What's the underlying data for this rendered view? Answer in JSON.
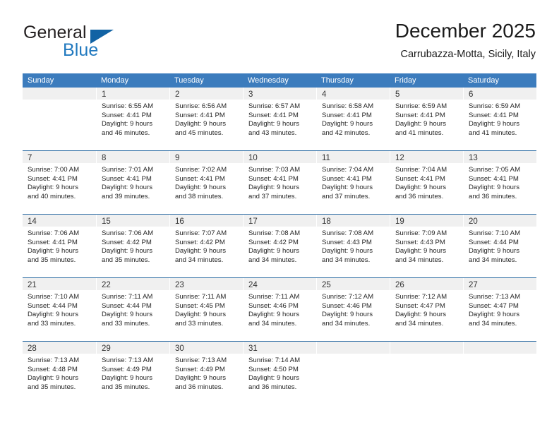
{
  "brand": {
    "name_part1": "General",
    "name_part2": "Blue",
    "logo_icon": "triangle-logo-icon",
    "accent_color": "#2179bf"
  },
  "header": {
    "title": "December 2025",
    "subtitle": "Carrubazza-Motta, Sicily, Italy"
  },
  "calendar": {
    "header_bg": "#3c7cbd",
    "daynum_bg": "#f0f0f0",
    "separator_color": "#2e6da4",
    "weekdays": [
      "Sunday",
      "Monday",
      "Tuesday",
      "Wednesday",
      "Thursday",
      "Friday",
      "Saturday"
    ],
    "weeks": [
      [
        {
          "day": "",
          "sunrise": "",
          "sunset": "",
          "daylight1": "",
          "daylight2": ""
        },
        {
          "day": "1",
          "sunrise": "Sunrise: 6:55 AM",
          "sunset": "Sunset: 4:41 PM",
          "daylight1": "Daylight: 9 hours",
          "daylight2": "and 46 minutes."
        },
        {
          "day": "2",
          "sunrise": "Sunrise: 6:56 AM",
          "sunset": "Sunset: 4:41 PM",
          "daylight1": "Daylight: 9 hours",
          "daylight2": "and 45 minutes."
        },
        {
          "day": "3",
          "sunrise": "Sunrise: 6:57 AM",
          "sunset": "Sunset: 4:41 PM",
          "daylight1": "Daylight: 9 hours",
          "daylight2": "and 43 minutes."
        },
        {
          "day": "4",
          "sunrise": "Sunrise: 6:58 AM",
          "sunset": "Sunset: 4:41 PM",
          "daylight1": "Daylight: 9 hours",
          "daylight2": "and 42 minutes."
        },
        {
          "day": "5",
          "sunrise": "Sunrise: 6:59 AM",
          "sunset": "Sunset: 4:41 PM",
          "daylight1": "Daylight: 9 hours",
          "daylight2": "and 41 minutes."
        },
        {
          "day": "6",
          "sunrise": "Sunrise: 6:59 AM",
          "sunset": "Sunset: 4:41 PM",
          "daylight1": "Daylight: 9 hours",
          "daylight2": "and 41 minutes."
        }
      ],
      [
        {
          "day": "7",
          "sunrise": "Sunrise: 7:00 AM",
          "sunset": "Sunset: 4:41 PM",
          "daylight1": "Daylight: 9 hours",
          "daylight2": "and 40 minutes."
        },
        {
          "day": "8",
          "sunrise": "Sunrise: 7:01 AM",
          "sunset": "Sunset: 4:41 PM",
          "daylight1": "Daylight: 9 hours",
          "daylight2": "and 39 minutes."
        },
        {
          "day": "9",
          "sunrise": "Sunrise: 7:02 AM",
          "sunset": "Sunset: 4:41 PM",
          "daylight1": "Daylight: 9 hours",
          "daylight2": "and 38 minutes."
        },
        {
          "day": "10",
          "sunrise": "Sunrise: 7:03 AM",
          "sunset": "Sunset: 4:41 PM",
          "daylight1": "Daylight: 9 hours",
          "daylight2": "and 37 minutes."
        },
        {
          "day": "11",
          "sunrise": "Sunrise: 7:04 AM",
          "sunset": "Sunset: 4:41 PM",
          "daylight1": "Daylight: 9 hours",
          "daylight2": "and 37 minutes."
        },
        {
          "day": "12",
          "sunrise": "Sunrise: 7:04 AM",
          "sunset": "Sunset: 4:41 PM",
          "daylight1": "Daylight: 9 hours",
          "daylight2": "and 36 minutes."
        },
        {
          "day": "13",
          "sunrise": "Sunrise: 7:05 AM",
          "sunset": "Sunset: 4:41 PM",
          "daylight1": "Daylight: 9 hours",
          "daylight2": "and 36 minutes."
        }
      ],
      [
        {
          "day": "14",
          "sunrise": "Sunrise: 7:06 AM",
          "sunset": "Sunset: 4:41 PM",
          "daylight1": "Daylight: 9 hours",
          "daylight2": "and 35 minutes."
        },
        {
          "day": "15",
          "sunrise": "Sunrise: 7:06 AM",
          "sunset": "Sunset: 4:42 PM",
          "daylight1": "Daylight: 9 hours",
          "daylight2": "and 35 minutes."
        },
        {
          "day": "16",
          "sunrise": "Sunrise: 7:07 AM",
          "sunset": "Sunset: 4:42 PM",
          "daylight1": "Daylight: 9 hours",
          "daylight2": "and 34 minutes."
        },
        {
          "day": "17",
          "sunrise": "Sunrise: 7:08 AM",
          "sunset": "Sunset: 4:42 PM",
          "daylight1": "Daylight: 9 hours",
          "daylight2": "and 34 minutes."
        },
        {
          "day": "18",
          "sunrise": "Sunrise: 7:08 AM",
          "sunset": "Sunset: 4:43 PM",
          "daylight1": "Daylight: 9 hours",
          "daylight2": "and 34 minutes."
        },
        {
          "day": "19",
          "sunrise": "Sunrise: 7:09 AM",
          "sunset": "Sunset: 4:43 PM",
          "daylight1": "Daylight: 9 hours",
          "daylight2": "and 34 minutes."
        },
        {
          "day": "20",
          "sunrise": "Sunrise: 7:10 AM",
          "sunset": "Sunset: 4:44 PM",
          "daylight1": "Daylight: 9 hours",
          "daylight2": "and 34 minutes."
        }
      ],
      [
        {
          "day": "21",
          "sunrise": "Sunrise: 7:10 AM",
          "sunset": "Sunset: 4:44 PM",
          "daylight1": "Daylight: 9 hours",
          "daylight2": "and 33 minutes."
        },
        {
          "day": "22",
          "sunrise": "Sunrise: 7:11 AM",
          "sunset": "Sunset: 4:44 PM",
          "daylight1": "Daylight: 9 hours",
          "daylight2": "and 33 minutes."
        },
        {
          "day": "23",
          "sunrise": "Sunrise: 7:11 AM",
          "sunset": "Sunset: 4:45 PM",
          "daylight1": "Daylight: 9 hours",
          "daylight2": "and 33 minutes."
        },
        {
          "day": "24",
          "sunrise": "Sunrise: 7:11 AM",
          "sunset": "Sunset: 4:46 PM",
          "daylight1": "Daylight: 9 hours",
          "daylight2": "and 34 minutes."
        },
        {
          "day": "25",
          "sunrise": "Sunrise: 7:12 AM",
          "sunset": "Sunset: 4:46 PM",
          "daylight1": "Daylight: 9 hours",
          "daylight2": "and 34 minutes."
        },
        {
          "day": "26",
          "sunrise": "Sunrise: 7:12 AM",
          "sunset": "Sunset: 4:47 PM",
          "daylight1": "Daylight: 9 hours",
          "daylight2": "and 34 minutes."
        },
        {
          "day": "27",
          "sunrise": "Sunrise: 7:13 AM",
          "sunset": "Sunset: 4:47 PM",
          "daylight1": "Daylight: 9 hours",
          "daylight2": "and 34 minutes."
        }
      ],
      [
        {
          "day": "28",
          "sunrise": "Sunrise: 7:13 AM",
          "sunset": "Sunset: 4:48 PM",
          "daylight1": "Daylight: 9 hours",
          "daylight2": "and 35 minutes."
        },
        {
          "day": "29",
          "sunrise": "Sunrise: 7:13 AM",
          "sunset": "Sunset: 4:49 PM",
          "daylight1": "Daylight: 9 hours",
          "daylight2": "and 35 minutes."
        },
        {
          "day": "30",
          "sunrise": "Sunrise: 7:13 AM",
          "sunset": "Sunset: 4:49 PM",
          "daylight1": "Daylight: 9 hours",
          "daylight2": "and 36 minutes."
        },
        {
          "day": "31",
          "sunrise": "Sunrise: 7:14 AM",
          "sunset": "Sunset: 4:50 PM",
          "daylight1": "Daylight: 9 hours",
          "daylight2": "and 36 minutes."
        },
        {
          "day": "",
          "sunrise": "",
          "sunset": "",
          "daylight1": "",
          "daylight2": ""
        },
        {
          "day": "",
          "sunrise": "",
          "sunset": "",
          "daylight1": "",
          "daylight2": ""
        },
        {
          "day": "",
          "sunrise": "",
          "sunset": "",
          "daylight1": "",
          "daylight2": ""
        }
      ]
    ]
  }
}
